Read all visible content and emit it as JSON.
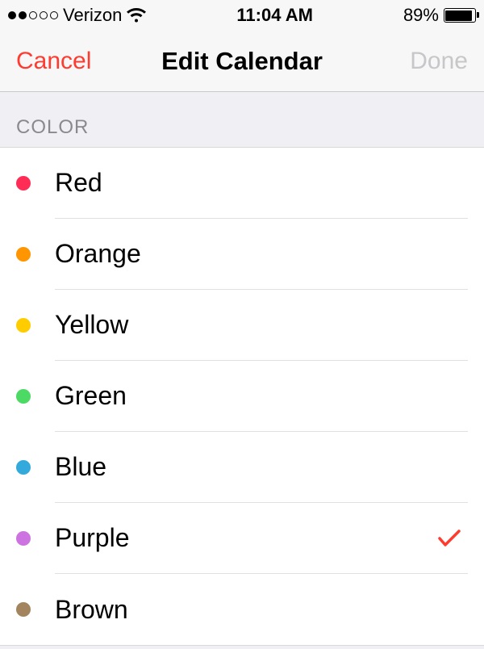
{
  "statusBar": {
    "carrier": "Verizon",
    "time": "11:04 AM",
    "batteryPct": "89%"
  },
  "nav": {
    "cancel": "Cancel",
    "title": "Edit Calendar",
    "done": "Done"
  },
  "section": {
    "header": "COLOR"
  },
  "colors": [
    {
      "label": "Red",
      "hex": "#ff2d55",
      "selected": false
    },
    {
      "label": "Orange",
      "hex": "#ff9500",
      "selected": false
    },
    {
      "label": "Yellow",
      "hex": "#ffcc00",
      "selected": false
    },
    {
      "label": "Green",
      "hex": "#4cd964",
      "selected": false
    },
    {
      "label": "Blue",
      "hex": "#34aadc",
      "selected": false
    },
    {
      "label": "Purple",
      "hex": "#cc73e1",
      "selected": true
    },
    {
      "label": "Brown",
      "hex": "#a2845e",
      "selected": false
    }
  ]
}
